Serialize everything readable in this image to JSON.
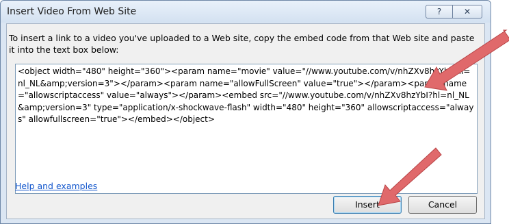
{
  "dialog": {
    "title": "Insert Video From Web Site",
    "help_button": "?",
    "close_button": "✕",
    "instructions": "To insert a link to a video you've uploaded to a Web site, copy the embed code from that Web site and paste it into the text box below:",
    "embed_code": "<object width=\"480\" height=\"360\"><param name=\"movie\" value=\"//www.youtube.com/v/nhZXv8hzYbI?hl=nl_NL&amp;version=3\"></param><param name=\"allowFullScreen\" value=\"true\"></param><param name=\"allowscriptaccess\" value=\"always\"></param><embed src=\"//www.youtube.com/v/nhZXv8hzYbI?hl=nl_NL&amp;version=3\" type=\"application/x-shockwave-flash\" width=\"480\" height=\"360\" allowscriptaccess=\"always\" allowfullscreen=\"true\"></embed></object>",
    "help_link": "Help and examples",
    "insert_label": "Insert",
    "cancel_label": "Cancel"
  },
  "annotations": {
    "arrow_color": "#e0696b"
  }
}
